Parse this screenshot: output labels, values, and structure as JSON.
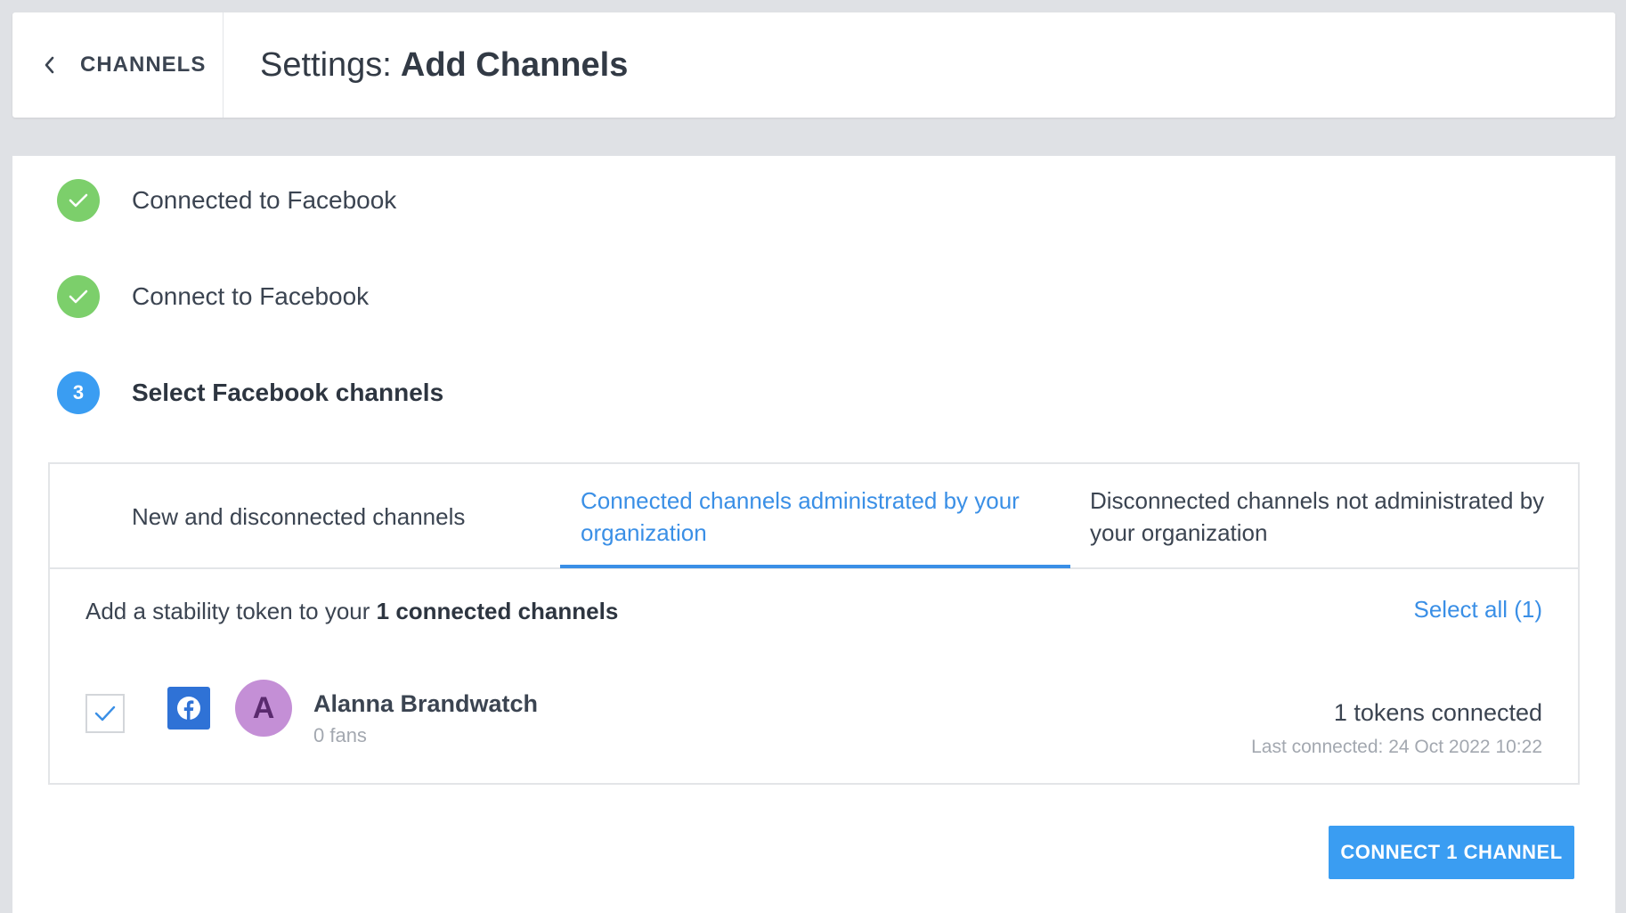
{
  "header": {
    "back_label": "CHANNELS",
    "title_prefix": "Settings:",
    "title_main": "Add Channels"
  },
  "steps": [
    {
      "label": "Connected to Facebook",
      "status": "done",
      "icon": "check-icon"
    },
    {
      "label": "Connect to Facebook",
      "status": "done",
      "icon": "check-icon"
    },
    {
      "label": "Select Facebook channels",
      "status": "current",
      "number": "3"
    }
  ],
  "tabs": [
    {
      "label": "New and disconnected channels",
      "active": false
    },
    {
      "label": "Connected channels administrated by your organization",
      "active": true
    },
    {
      "label": "Disconnected channels not administrated by your organization",
      "active": false
    }
  ],
  "panel": {
    "subhead_prefix": "Add a stability token to your",
    "subhead_bold": "1 connected channels",
    "select_all": "Select all (1)"
  },
  "channel": {
    "checked": true,
    "network_icon": "facebook-icon",
    "avatar_letter": "A",
    "name": "Alanna Brandwatch",
    "fans": "0 fans",
    "tokens": "1 tokens connected",
    "last_connected": "Last connected: 24 Oct 2022 10:22"
  },
  "actions": {
    "connect_label": "CONNECT 1 CHANNEL"
  },
  "colors": {
    "accent": "#3a9df2",
    "link": "#3a8fe6",
    "success": "#7ccf6b",
    "facebook": "#2f72d6",
    "avatar": "#c48fd6",
    "background": "#dfe1e5"
  }
}
